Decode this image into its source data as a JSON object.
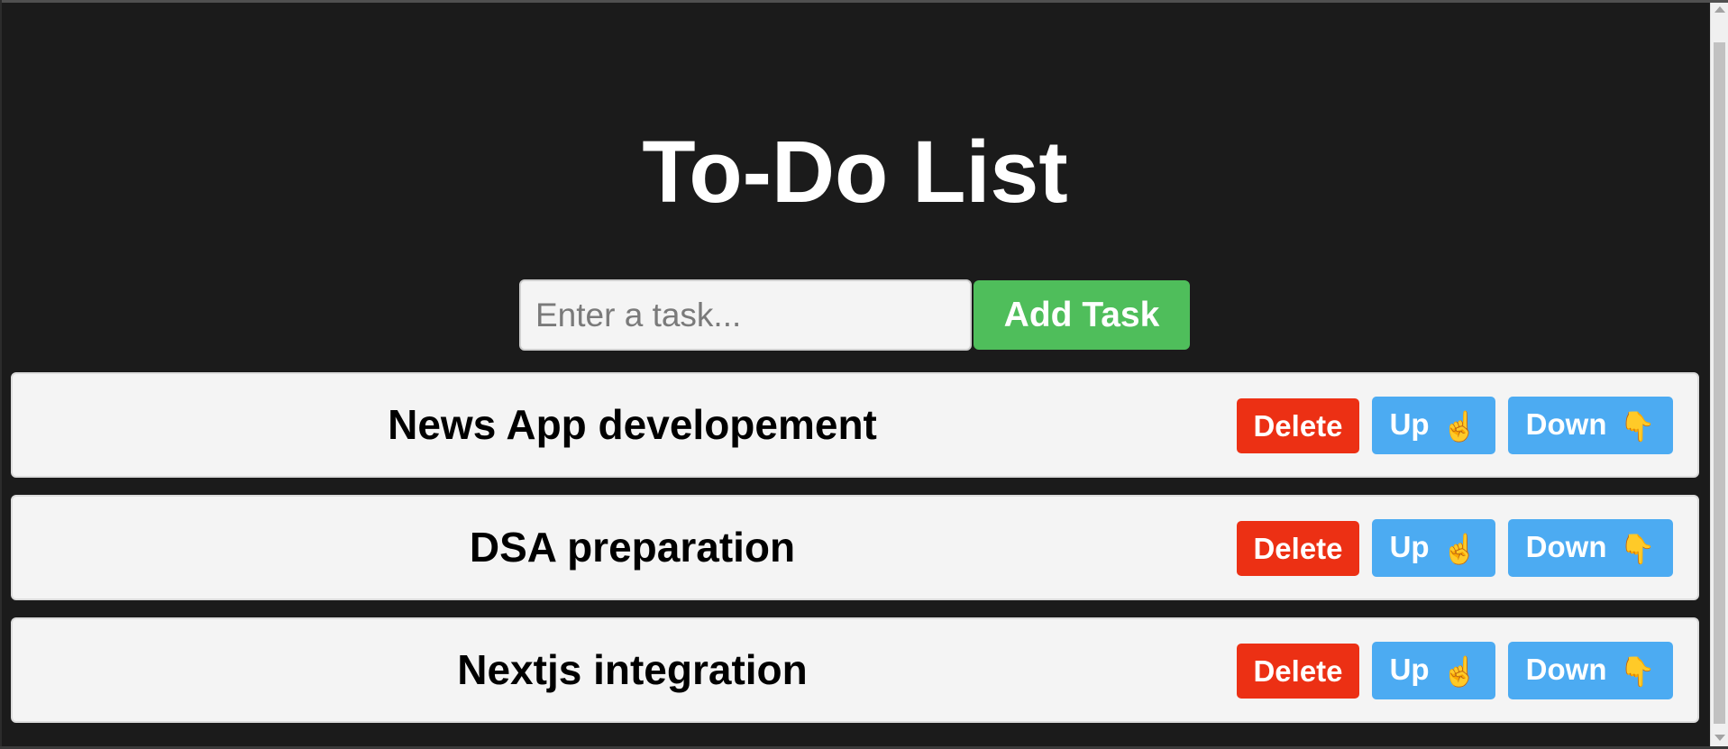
{
  "app": {
    "title": "To-Do List"
  },
  "input": {
    "placeholder": "Enter a task...",
    "value": ""
  },
  "add_button": {
    "label": "Add Task"
  },
  "colors": {
    "background": "#1b1b1b",
    "add": "#4fbe5b",
    "delete": "#ec3014",
    "move": "#4cabf2",
    "item_background": "#f4f4f4"
  },
  "tasks": [
    {
      "text": "News App developement",
      "delete_label": "Delete",
      "up_label": "Up",
      "up_icon": "☝",
      "down_label": "Down",
      "down_icon": "👇"
    },
    {
      "text": "DSA preparation",
      "delete_label": "Delete",
      "up_label": "Up",
      "up_icon": "☝",
      "down_label": "Down",
      "down_icon": "👇"
    },
    {
      "text": "Nextjs integration",
      "delete_label": "Delete",
      "up_label": "Up",
      "up_icon": "☝",
      "down_label": "Down",
      "down_icon": "👇"
    }
  ],
  "icons": {
    "up": "pointing-up-hand-icon",
    "down": "pointing-down-hand-icon",
    "scroll_up": "scroll-up-arrow-icon",
    "scroll_down": "scroll-down-arrow-icon"
  }
}
